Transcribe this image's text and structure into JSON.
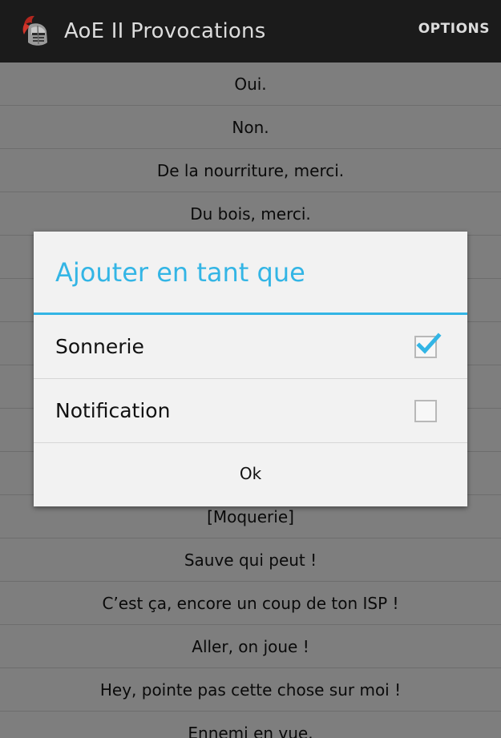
{
  "action_bar": {
    "title": "AoE II Provocations",
    "options_label": "OPTIONS",
    "icon": "knight-helmet-icon"
  },
  "list": {
    "items": [
      "Oui.",
      "Non.",
      "De la nourriture, merci.",
      "Du bois, merci.",
      "",
      "",
      "",
      "",
      "",
      "",
      "[Moquerie]",
      "Sauve qui peut !",
      "C’est ça, encore un coup de ton ISP !",
      "Aller, on joue !",
      "Hey, pointe pas cette chose sur moi !",
      "Ennemi en vue."
    ]
  },
  "dialog": {
    "title": "Ajouter en tant que",
    "options": [
      {
        "label": "Sonnerie",
        "checked": true
      },
      {
        "label": "Notification",
        "checked": false
      }
    ],
    "ok_label": "Ok"
  },
  "colors": {
    "accent": "#33b5e5",
    "action_bar_bg": "#1b1b1b",
    "dialog_bg": "#f2f2f2"
  }
}
